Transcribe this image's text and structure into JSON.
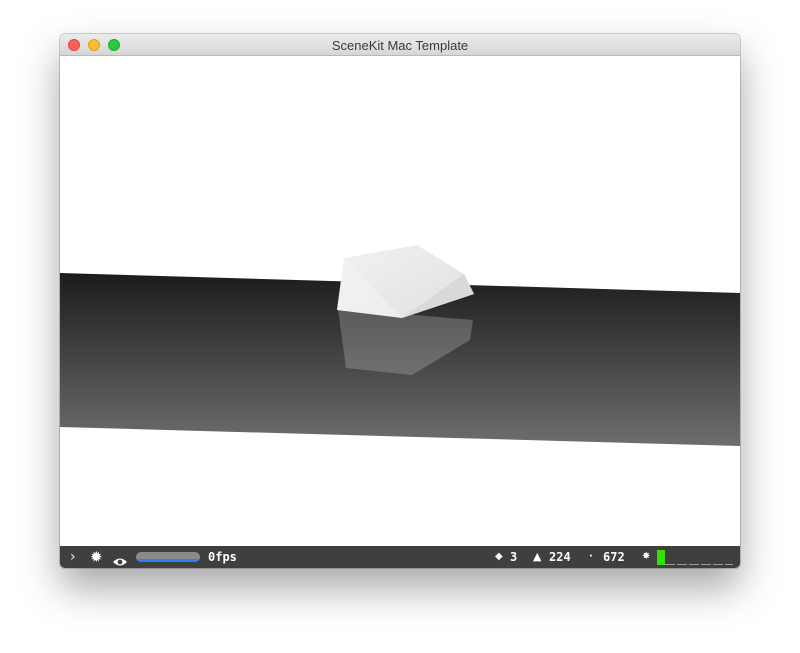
{
  "window": {
    "title": "SceneKit Mac Template"
  },
  "titlebar": {
    "buttons": [
      "close",
      "minimize",
      "zoom"
    ]
  },
  "viewport": {
    "background": "#ffffff",
    "floor_color_top": "#1c1c1c",
    "floor_color_bottom": "#6e6e6e",
    "object_color": "#ececec"
  },
  "statistics": {
    "expand_icon": "chevron-right-icon",
    "settings_icon": "gear-icon",
    "visibility_icon": "eye-icon",
    "frame_progress": 1.0,
    "progress_color": "#2f7ef6",
    "fps_label": "0fps",
    "nodes_icon": "◆",
    "nodes_count": "3",
    "triangles_icon": "▲",
    "triangles_count": "224",
    "points_icon": "·",
    "points_count": "672",
    "lights_icon": "✸",
    "performance_color": "#34e000"
  }
}
